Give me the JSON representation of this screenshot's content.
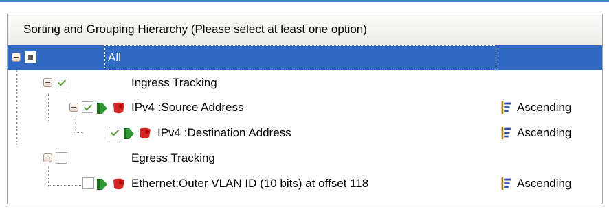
{
  "header": {
    "title": "Sorting and Grouping Hierarchy (Please select at least one option)"
  },
  "tree": {
    "all": {
      "label": "All"
    },
    "ingress": {
      "label": "Ingress Tracking"
    },
    "ipv4_source": {
      "label": "IPv4 :Source Address",
      "order": "Ascending"
    },
    "ipv4_destination": {
      "label": "IPv4 :Destination Address",
      "order": "Ascending"
    },
    "egress": {
      "label": "Egress Tracking"
    },
    "ethernet_vlan": {
      "label": "Ethernet:Outer VLAN ID (10 bits) at offset 118",
      "order": "Ascending"
    }
  },
  "colors": {
    "selection": "#316ac5",
    "frame_border": "#a7a6aa"
  }
}
